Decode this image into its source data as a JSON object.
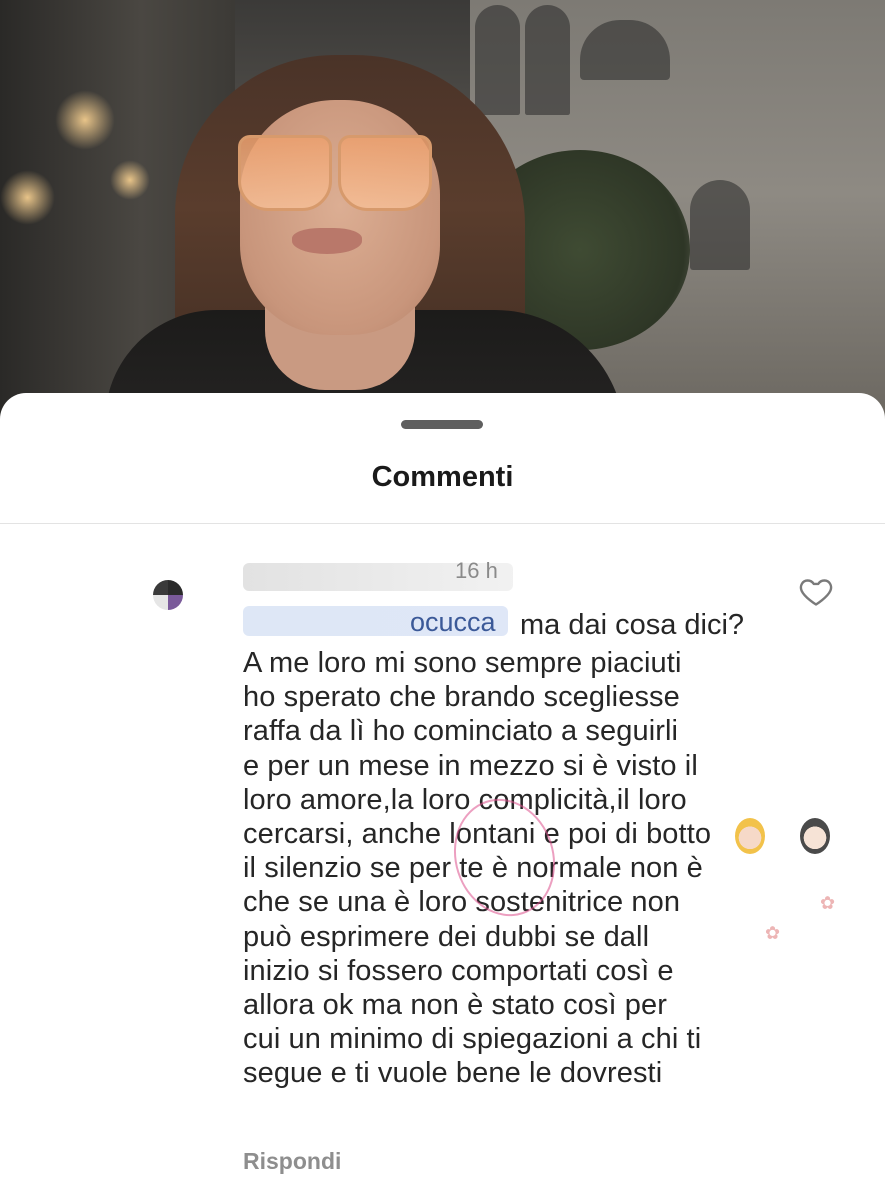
{
  "sheet": {
    "title": "Commenti"
  },
  "comment": {
    "time": "16 h",
    "mention_tail": "ocucca",
    "first_line": "ma dai cosa dici?",
    "lines": [
      "A me loro mi sono sempre piaciuti",
      "ho sperato che brando scegliesse",
      "raffa  da lì ho cominciato a seguirli",
      "e per un mese in mezzo si è visto il",
      "loro amore,la loro complicità,il loro",
      "cercarsi, anche lontani e poi di botto",
      "il silenzio se per te è normale non è",
      "che se una è loro sostenitrice non",
      "può  esprimere dei dubbi se dall",
      "inizio si fossero comportati così e",
      "allora ok ma non è stato così per",
      "cui un minimo di spiegazioni a chi ti",
      "segue e ti vuole bene le dovresti"
    ],
    "reply_label": "Rispondi"
  },
  "icons": {
    "like": "heart-outline-icon",
    "avatar": "avatar"
  },
  "colors": {
    "text": "#262626",
    "muted": "#8e8e8e",
    "mention": "#3b5998"
  }
}
